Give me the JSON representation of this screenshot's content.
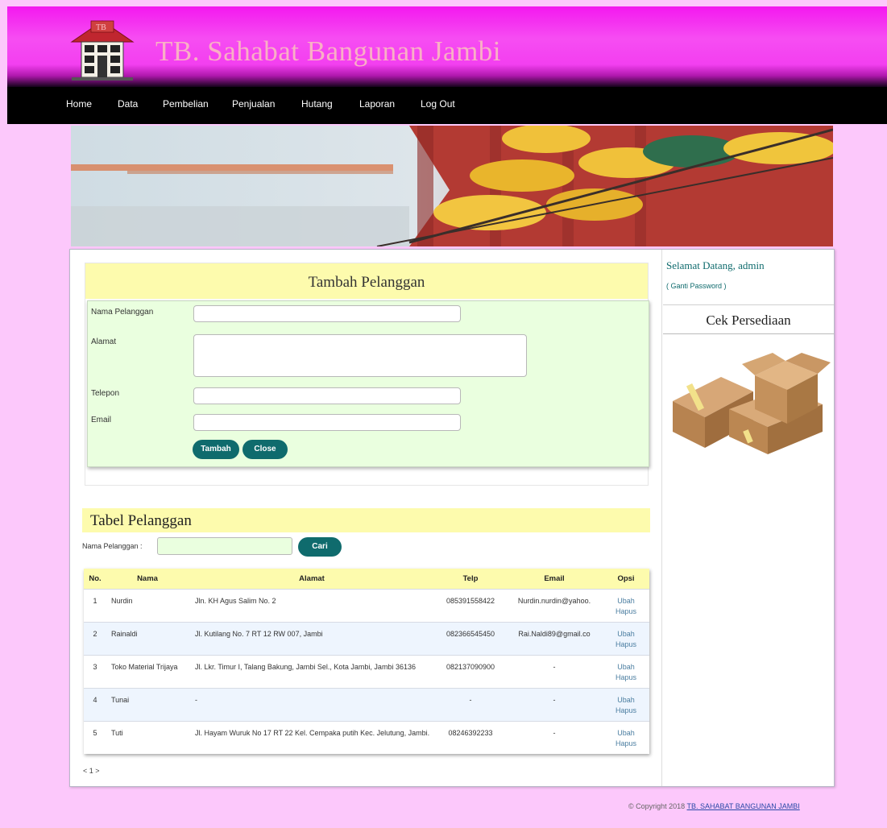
{
  "site": {
    "title": "TB. Sahabat Bangunan Jambi"
  },
  "nav": {
    "items": [
      "Home",
      "Data",
      "Pembelian",
      "Penjualan",
      "Hutang",
      "Laporan",
      "Log Out"
    ]
  },
  "form": {
    "title": "Tambah Pelanggan",
    "fields": {
      "nama": {
        "label": "Nama Pelanggan",
        "value": ""
      },
      "alamat": {
        "label": "Alamat",
        "value": ""
      },
      "telepon": {
        "label": "Telepon",
        "value": ""
      },
      "email": {
        "label": "Email",
        "value": ""
      }
    },
    "buttons": {
      "submit": "Tambah",
      "close": "Close"
    }
  },
  "table_section": {
    "title": "Tabel Pelanggan",
    "search": {
      "label": "Nama Pelanggan :",
      "value": "",
      "button": "Cari"
    },
    "columns": [
      "No.",
      "Nama",
      "Alamat",
      "Telp",
      "Email",
      "Opsi"
    ],
    "rows": [
      {
        "no": "1",
        "nama": "Nurdin",
        "alamat": "Jln. KH Agus Salim No. 2",
        "telp": "085391558422",
        "email": "Nurdin.nurdin@yahoo.",
        "ubah": "Ubah",
        "hapus": "Hapus"
      },
      {
        "no": "2",
        "nama": "Rainaldi",
        "alamat": "Jl. Kutilang No. 7 RT 12 RW 007, Jambi",
        "telp": "082366545450",
        "email": "Rai.Naldi89@gmail.co",
        "ubah": "Ubah",
        "hapus": "Hapus"
      },
      {
        "no": "3",
        "nama": "Toko Material Trijaya",
        "alamat": "Jl. Lkr. Timur I, Talang Bakung, Jambi Sel., Kota Jambi, Jambi 36136",
        "telp": "082137090900",
        "email": "-",
        "ubah": "Ubah",
        "hapus": "Hapus"
      },
      {
        "no": "4",
        "nama": "Tunai",
        "alamat": "-",
        "telp": "-",
        "email": "-",
        "ubah": "Ubah",
        "hapus": "Hapus"
      },
      {
        "no": "5",
        "nama": "Tuti",
        "alamat": "Jl. Hayam Wuruk No 17 RT 22 Kel. Cempaka putih Kec. Jelutung, Jambi.",
        "telp": "08246392233",
        "email": "-",
        "ubah": "Ubah",
        "hapus": "Hapus"
      }
    ],
    "pager": "< 1 >"
  },
  "sidebar": {
    "welcome": "Selamat Datang, admin",
    "change_password": "( Ganti Password )",
    "stock_title": "Cek Persediaan"
  },
  "footer": {
    "prefix": "© Copyright 2018",
    "link": "TB. SAHABAT BANGUNAN JAMBI"
  },
  "colors": {
    "page_bg": "#fcc8fb",
    "header_magenta": "#f318ef",
    "accent_teal": "#0f6b6d",
    "panel_yellow": "#fdfbad",
    "form_green": "#eaffdf"
  }
}
